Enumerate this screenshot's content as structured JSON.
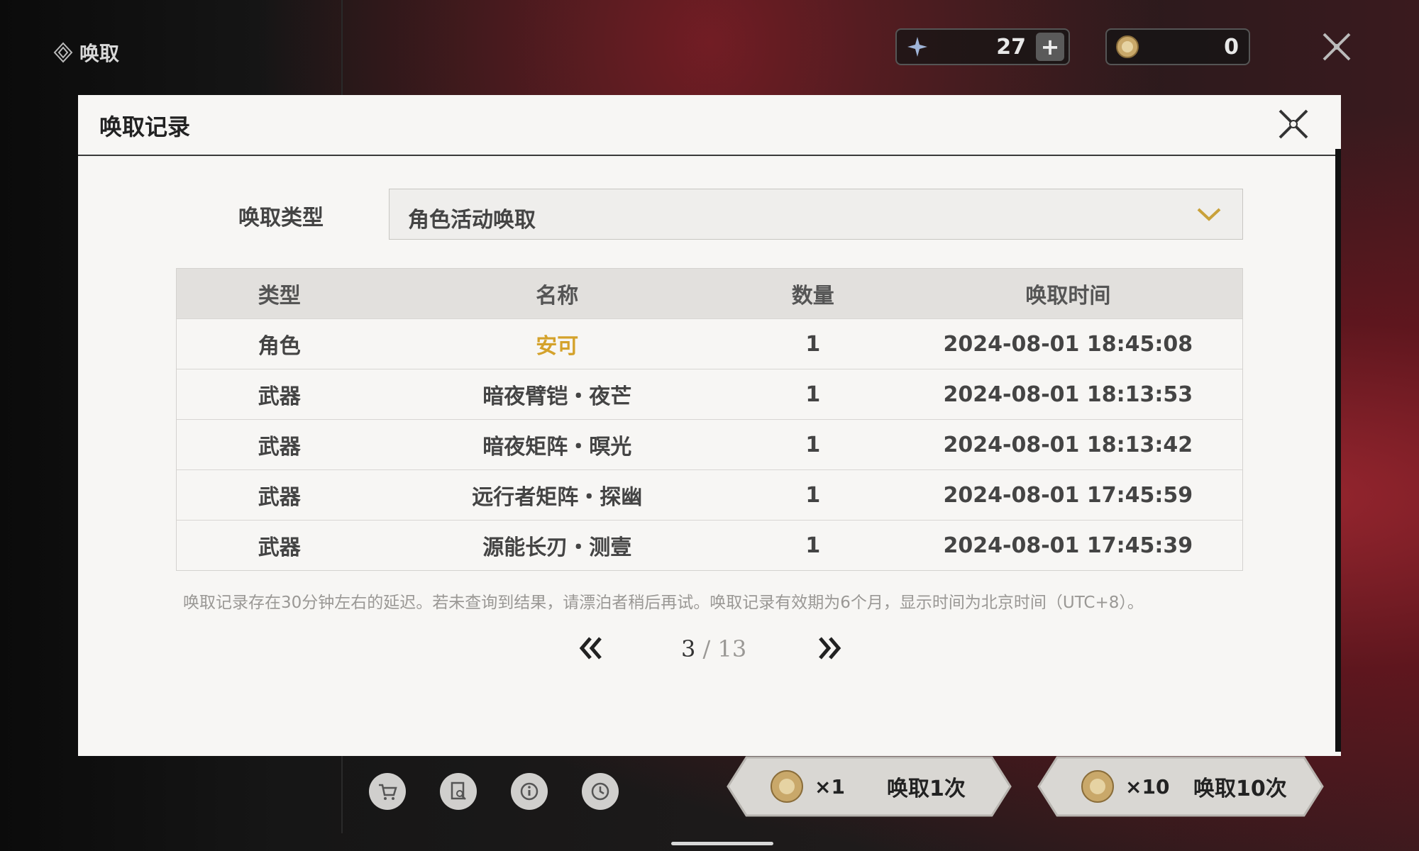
{
  "header": {
    "section_title": "唤取",
    "currency_primary_value": "27",
    "currency_secondary_value": "0"
  },
  "modal": {
    "title": "唤取记录",
    "type_label": "唤取类型",
    "selected_type": "角色活动唤取",
    "columns": [
      "类型",
      "名称",
      "数量",
      "唤取时间"
    ],
    "rows": [
      {
        "type": "角色",
        "name": "安可",
        "qty": "1",
        "time": "2024-08-01 18:45:08"
      },
      {
        "type": "武器",
        "name": "暗夜臂铠・夜芒",
        "qty": "1",
        "time": "2024-08-01 18:13:53"
      },
      {
        "type": "武器",
        "name": "暗夜矩阵・暝光",
        "qty": "1",
        "time": "2024-08-01 18:13:42"
      },
      {
        "type": "武器",
        "name": "远行者矩阵・探幽",
        "qty": "1",
        "time": "2024-08-01 17:45:59"
      },
      {
        "type": "武器",
        "name": "源能长刃・测壹",
        "qty": "1",
        "time": "2024-08-01 17:45:39"
      }
    ],
    "note": "唤取记录存在30分钟左右的延迟。若未查询到结果，请漂泊者稍后再试。唤取记录有效期为6个月，显示时间为北京时间（UTC+8）。",
    "page_current": "3",
    "page_separator": " / ",
    "page_total": "13"
  },
  "footer": {
    "pull_one_count": "×1",
    "pull_one_label": "唤取1次",
    "pull_ten_count": "×10",
    "pull_ten_label": "唤取10次"
  },
  "colors": {
    "highlight_name": "#d4a22b",
    "modal_bg": "#f7f6f4",
    "header_row_bg": "#e2e0dd"
  },
  "icons": [
    "convene-icon",
    "star-currency-icon",
    "plus-icon",
    "coin-icon",
    "close-icon",
    "chevron-down-icon",
    "double-chevron-left-icon",
    "double-chevron-right-icon",
    "shop-icon",
    "record-icon",
    "info-icon",
    "history-icon"
  ]
}
